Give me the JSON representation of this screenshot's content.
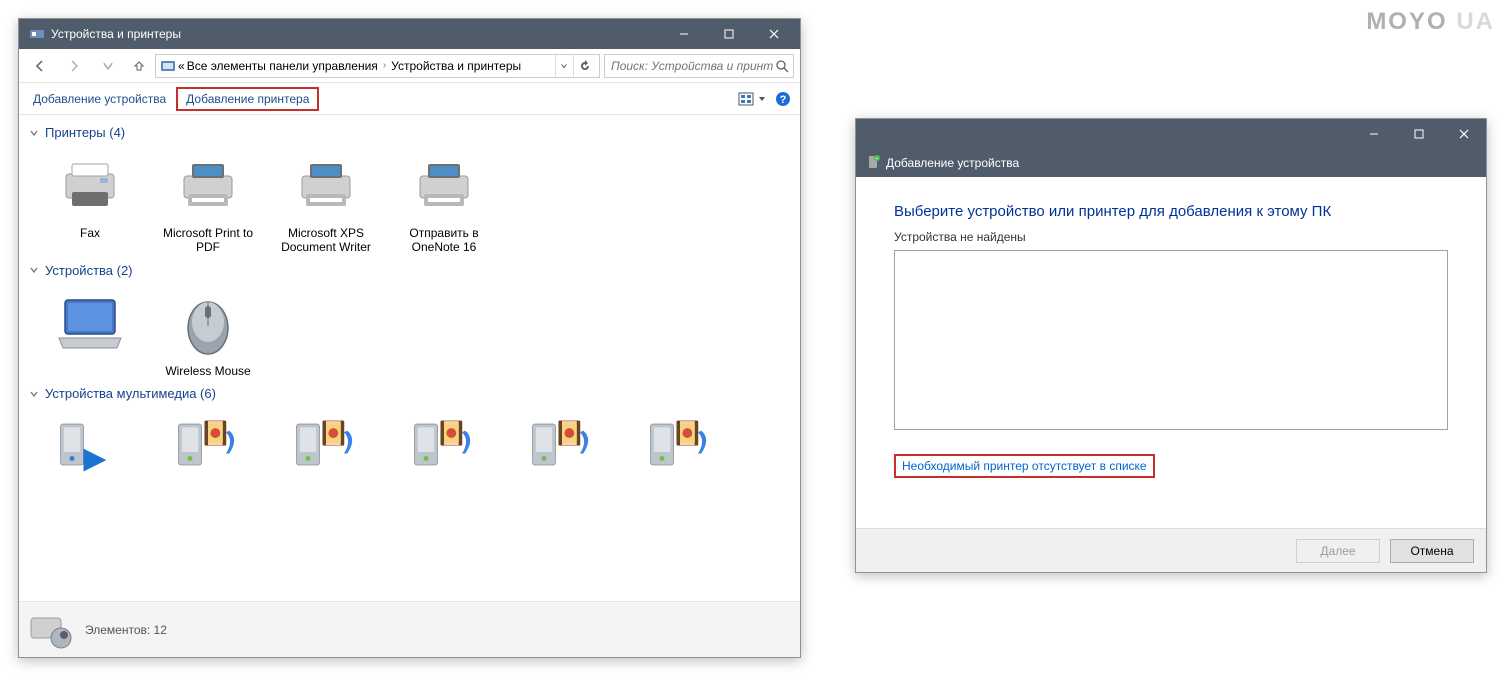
{
  "watermark": {
    "moyo": "MOYO",
    "ua": "UA"
  },
  "mainWindow": {
    "title": "Устройства и принтеры",
    "breadcrumb": {
      "prefix": "«",
      "segment1": "Все элементы панели управления",
      "segment2": "Устройства и принтеры"
    },
    "search_placeholder": "Поиск: Устройства и принте...",
    "toolbar": {
      "add_device": "Добавление устройства",
      "add_printer": "Добавление принтера"
    },
    "groups": {
      "printers": {
        "label": "Принтеры (4)",
        "items": [
          {
            "label": "Fax"
          },
          {
            "label": "Microsoft Print to PDF"
          },
          {
            "label": "Microsoft XPS Document Writer"
          },
          {
            "label": "Отправить в OneNote 16"
          }
        ]
      },
      "devices": {
        "label": "Устройства (2)",
        "items": [
          {
            "label": "        ",
            "blurred": true,
            "icon": "laptop"
          },
          {
            "label": "Wireless Mouse",
            "icon": "mouse"
          }
        ]
      },
      "multimedia": {
        "label": "Устройства мультимедиа (6)",
        "count": 6
      }
    },
    "status": "Элементов: 12"
  },
  "wizard": {
    "caption": "Добавление устройства",
    "heading": "Выберите устройство или принтер для добавления к этому ПК",
    "sub": "Устройства не найдены",
    "missing_link": "Необходимый принтер отсутствует в списке",
    "btn_next": "Далее",
    "btn_cancel": "Отмена"
  }
}
